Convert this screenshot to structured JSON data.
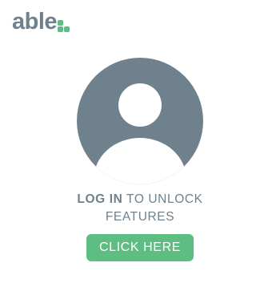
{
  "logo": {
    "text": "able"
  },
  "message": {
    "strong": "LOG IN",
    "rest": " TO UNLOCK",
    "line2": "FEATURES"
  },
  "cta": {
    "label": "CLICK HERE"
  },
  "icons": {
    "avatar": "user-avatar-placeholder"
  },
  "colors": {
    "brand_text": "#6f818d",
    "accent": "#5ebd82",
    "avatar": "#6f818d",
    "background": "#ffffff"
  }
}
